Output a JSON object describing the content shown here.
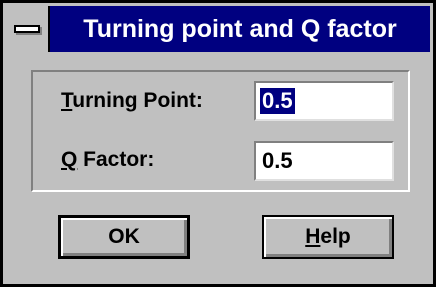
{
  "window": {
    "title": "Turning point and Q factor"
  },
  "fields": [
    {
      "label_mnemonic": "T",
      "label_rest": "urning Point:",
      "value": "0.5",
      "selected": true
    },
    {
      "label_mnemonic": "Q",
      "label_rest": " Factor:",
      "value": "0.5",
      "selected": false
    }
  ],
  "buttons": {
    "ok_label": "OK",
    "help_mnemonic": "H",
    "help_rest": "elp"
  },
  "colors": {
    "titlebar": "#000080",
    "face": "#c0c0c0",
    "selection": "#000080"
  }
}
